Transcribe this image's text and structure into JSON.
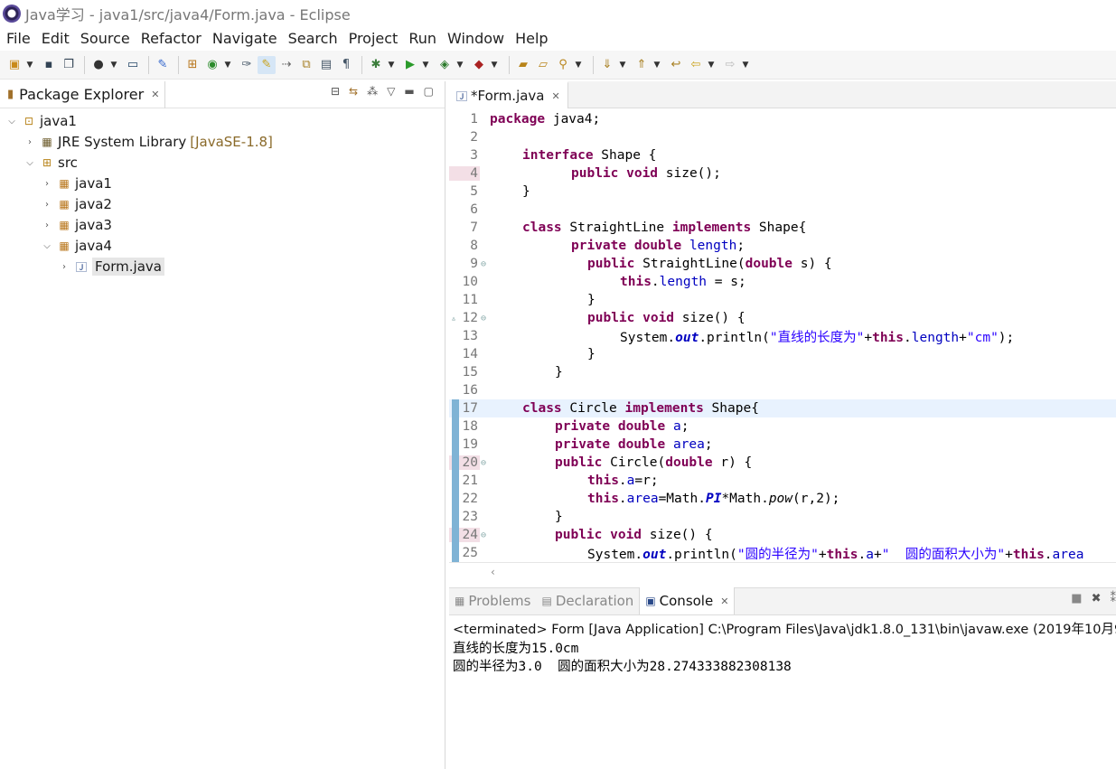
{
  "window": {
    "title": "Java学习 - java1/src/java4/Form.java - Eclipse"
  },
  "menu": [
    "File",
    "Edit",
    "Source",
    "Refactor",
    "Navigate",
    "Search",
    "Project",
    "Run",
    "Window",
    "Help"
  ],
  "package_explorer": {
    "tab_label": "Package Explorer",
    "tree": {
      "project": "java1",
      "jre_library": "JRE System Library",
      "jre_version": "[JavaSE-1.8]",
      "src": "src",
      "packages": [
        "java1",
        "java2",
        "java3",
        "java4"
      ],
      "file": "Form.java"
    }
  },
  "editor": {
    "tab_label": "*Form.java",
    "line_numbers": [
      "1",
      "2",
      "3",
      "4",
      "5",
      "6",
      "7",
      "8",
      "9",
      "10",
      "11",
      "12",
      "13",
      "14",
      "15",
      "16",
      "17",
      "18",
      "19",
      "20",
      "21",
      "22",
      "23",
      "24",
      "25"
    ],
    "code": {
      "l1_kw": "package",
      "l1_rest": " java4;",
      "l3_kw": "interface",
      "l3_rest": " Shape {",
      "l4_kw": "public void",
      "l4_rest": " size();",
      "l5": "}",
      "l7_kw1": "class",
      "l7_mid": " StraightLine ",
      "l7_kw2": "implements",
      "l7_rest": " Shape{",
      "l8_kw": "private double",
      "l8_fld": " length",
      "l8_rest": ";",
      "l9_kw": "public",
      "l9_mid": " StraightLine(",
      "l9_kw2": "double",
      "l9_rest": " s) {",
      "l10_kw": "this",
      "l10_dot": ".",
      "l10_fld": "length",
      "l10_rest": " = s;",
      "l11": "}",
      "l12_kw": "public void",
      "l12_rest": " size() {",
      "l13_a": "System.",
      "l13_out": "out",
      "l13_b": ".println(",
      "l13_str": "\"直线的长度为\"",
      "l13_c": "+",
      "l13_this": "this",
      "l13_d": ".",
      "l13_fld": "length",
      "l13_e": "+",
      "l13_str2": "\"cm\"",
      "l13_f": ");",
      "l14": "}",
      "l15": "}",
      "l17_kw1": "class",
      "l17_mid": " Circle ",
      "l17_kw2": "implements",
      "l17_rest": " Shape{",
      "l18_kw": "private double",
      "l18_fld": " a",
      "l18_rest": ";",
      "l19_kw": "private double",
      "l19_fld": " area",
      "l19_rest": ";",
      "l20_kw": "public",
      "l20_mid": " Circle(",
      "l20_kw2": "double",
      "l20_rest": " r) {",
      "l21_kw": "this",
      "l21_dot": ".",
      "l21_fld": "a",
      "l21_rest": "=r;",
      "l22_kw": "this",
      "l22_dot": ".",
      "l22_fld": "area",
      "l22_a": "=Math.",
      "l22_pi": "PI",
      "l22_b": "*Math.",
      "l22_pow": "pow",
      "l22_c": "(r,2);",
      "l23": "}",
      "l24_kw": "public void",
      "l24_rest": " size() {",
      "l25_a": "System.",
      "l25_out": "out",
      "l25_b": ".println(",
      "l25_str": "\"圆的半径为\"",
      "l25_c": "+",
      "l25_this": "this",
      "l25_d": ".",
      "l25_fld": "a",
      "l25_e": "+",
      "l25_str2": "\"  圆的面积大小为\"",
      "l25_f": "+",
      "l25_this2": "this",
      "l25_g": ".",
      "l25_fld2": "area"
    }
  },
  "bottom_panel": {
    "tabs": [
      "Problems",
      "Declaration",
      "Console"
    ],
    "active_tab": "Console",
    "status": "<terminated> Form [Java Application] C:\\Program Files\\Java\\jdk1.8.0_131\\bin\\javaw.exe (2019年10月9",
    "output": [
      "直线的长度为15.0cm",
      "圆的半径为3.0  圆的面积大小为28.274333882308138"
    ]
  },
  "colors": {
    "keyword": "#7f0055",
    "field": "#0000c0",
    "string": "#2a00ff",
    "current_line": "#e8f2fe",
    "ruler_marker": "#7fb3d5"
  }
}
